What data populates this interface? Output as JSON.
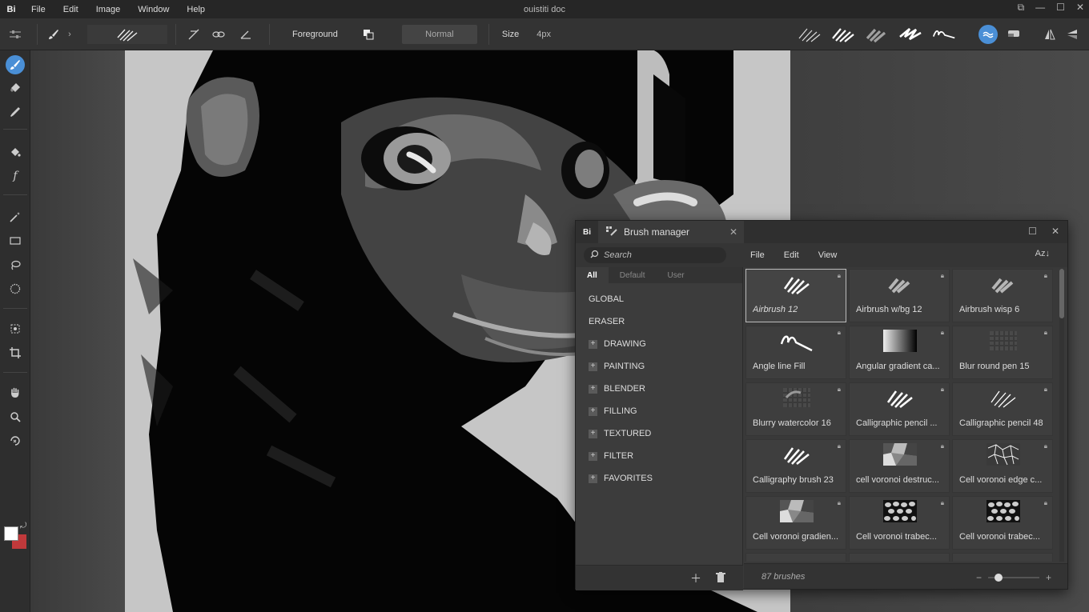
{
  "app": {
    "logo": "Bi",
    "title": "ouistiti doc"
  },
  "menu": [
    "File",
    "Edit",
    "Image",
    "Window",
    "Help"
  ],
  "toolbar": {
    "foreground_label": "Foreground",
    "blend_mode": "Normal",
    "size_label": "Size",
    "size_value": "4px"
  },
  "panel": {
    "logo": "Bi",
    "title": "Brush manager",
    "search_placeholder": "Search",
    "menu": [
      "File",
      "Edit",
      "View"
    ],
    "sort_label": "Az↓",
    "filter_tabs": [
      {
        "label": "All",
        "active": true
      },
      {
        "label": "Default",
        "active": false
      },
      {
        "label": "User",
        "active": false
      }
    ],
    "categories": [
      {
        "label": "GLOBAL",
        "expandable": false
      },
      {
        "label": "ERASER",
        "expandable": false
      },
      {
        "label": "DRAWING",
        "expandable": true
      },
      {
        "label": "PAINTING",
        "expandable": true
      },
      {
        "label": "BLENDER",
        "expandable": true
      },
      {
        "label": "FILLING",
        "expandable": true
      },
      {
        "label": "TEXTURED",
        "expandable": true
      },
      {
        "label": "FILTER",
        "expandable": true
      },
      {
        "label": "FAVORITES",
        "expandable": true
      }
    ],
    "brushes": [
      {
        "name": "Airbrush 12",
        "thumb": "scribble-white",
        "selected": true
      },
      {
        "name": "Airbrush w/bg 12",
        "thumb": "scribble-soft"
      },
      {
        "name": "Airbrush wisp 6",
        "thumb": "scribble-soft"
      },
      {
        "name": "Angle line Fill",
        "thumb": "angle-line"
      },
      {
        "name": "Angular gradient ca...",
        "thumb": "gradient"
      },
      {
        "name": "Blur round pen 15",
        "thumb": "checker"
      },
      {
        "name": "Blurry watercolor 16",
        "thumb": "checker-stroke"
      },
      {
        "name": "Calligraphic pencil ...",
        "thumb": "scribble-white"
      },
      {
        "name": "Calligraphic pencil 48",
        "thumb": "scribble-lines"
      },
      {
        "name": "Calligraphy brush 23",
        "thumb": "scribble-white"
      },
      {
        "name": "cell voronoi destruc...",
        "thumb": "voronoi-gray"
      },
      {
        "name": "Cell voronoi edge c...",
        "thumb": "voronoi-edge"
      },
      {
        "name": "Cell voronoi gradien...",
        "thumb": "voronoi-gray"
      },
      {
        "name": "Cell voronoi trabec...",
        "thumb": "voronoi-cells"
      },
      {
        "name": "Cell voronoi trabec...",
        "thumb": "voronoi-cells"
      }
    ],
    "count_label": "87 brushes"
  },
  "colors": {
    "foreground": "#ffffff",
    "background": "#c0393b",
    "accent": "#4a8fd6"
  }
}
